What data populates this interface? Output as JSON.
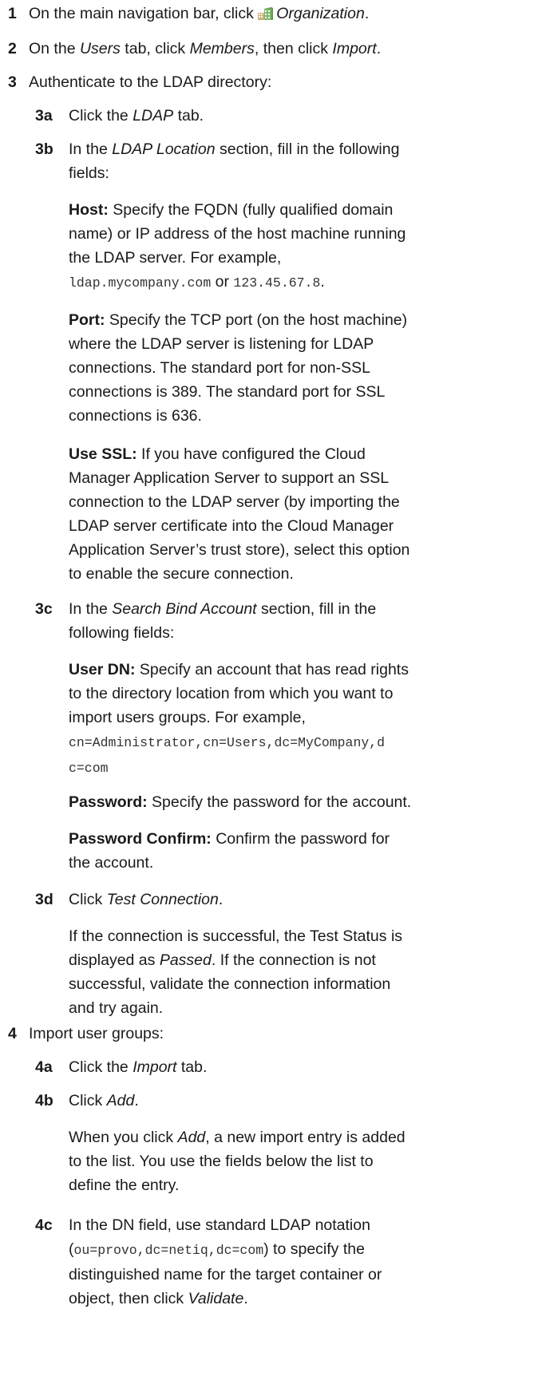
{
  "steps": {
    "s1": {
      "num": "1",
      "pre": "On the main navigation bar, click ",
      "em": "Organization",
      "post": "."
    },
    "s2": {
      "num": "2",
      "pre": "On the ",
      "em1": "Users",
      "mid": " tab, click ",
      "em2": "Members",
      "mid2": ", then click ",
      "em3": "Import",
      "post": "."
    },
    "s3": {
      "num": "3",
      "text": "Authenticate to the LDAP directory:"
    },
    "s3a": {
      "num": "3a",
      "pre": "Click the ",
      "em": "LDAP",
      "post": " tab."
    },
    "s3b": {
      "num": "3b",
      "pre": "In the ",
      "em": "LDAP Location",
      "post": " section, fill in the following",
      "post2": "fields:"
    },
    "host": {
      "term": "Host:",
      "l1": " Specify the FQDN (fully qualified domain",
      "l2": "name) or IP address of the host machine running",
      "l3": "the LDAP server. For example,",
      "code1": "ldap.mycompany.com",
      "or": " or ",
      "code2": "123.45.67.8",
      "end": "."
    },
    "port": {
      "term": "Port:",
      "l1": " Specify the TCP port (on the host machine)",
      "l2": "where the LDAP server is listening for LDAP",
      "l3": "connections. The standard port for non-SSL",
      "l4": "connections is 389. The standard port for SSL",
      "l5": "connections is 636."
    },
    "ssl": {
      "term": "Use SSL:",
      "l1": " If you have configured the Cloud",
      "l2": "Manager Application Server to support an SSL",
      "l3": "connection to the LDAP server (by importing the",
      "l4": "LDAP server certificate into the Cloud Manager",
      "l5": "Application Server’s trust store), select this option",
      "l6": "to enable the secure connection."
    },
    "s3c": {
      "num": "3c",
      "pre": "In the ",
      "em": "Search Bind Account",
      "post": " section, fill in the",
      "post2": "following fields:"
    },
    "userdn": {
      "term": "User DN:",
      "l1": " Specify an account that has read rights",
      "l2": "to the directory location from which you want to",
      "l3": "import users groups. For example,",
      "code1": "cn=Administrator,cn=Users,dc=MyCompany,d",
      "code2": "c=com"
    },
    "password": {
      "term": "Password:",
      "text": " Specify the password for the account."
    },
    "pwconfirm": {
      "term": "Password Confirm:",
      "l1": " Confirm the password for",
      "l2": "the account."
    },
    "s3d": {
      "num": "3d",
      "pre": "Click ",
      "em": "Test Connection",
      "post": "."
    },
    "testresult": {
      "l1": "If the connection is successful, the Test Status is",
      "l2pre": "displayed as ",
      "l2em": "Passed",
      "l2post": ". If the connection is not",
      "l3": "successful, validate the connection information",
      "l4": "and try again."
    },
    "s4": {
      "num": "4",
      "text": "Import user groups:"
    },
    "s4a": {
      "num": "4a",
      "pre": "Click the ",
      "em": "Import",
      "post": " tab."
    },
    "s4b": {
      "num": "4b",
      "pre": "Click ",
      "em": "Add",
      "post": "."
    },
    "addnote": {
      "l1pre": "When you click ",
      "l1em": "Add",
      "l1post": ", a new import entry is added",
      "l2": "to the list. You use the fields below the list to",
      "l3": "define the entry."
    },
    "s4c": {
      "num": "4c",
      "l1": "In the DN field, use standard LDAP notation",
      "l2pre": "(",
      "l2code": "ou=provo,dc=netiq,dc=com",
      "l2post": ") to specify the",
      "l3": "distinguished name for the target container or",
      "l4pre": "object, then click ",
      "l4em": "Validate",
      "l4post": "."
    }
  },
  "icons": {
    "organization": "organization-building-icon"
  }
}
